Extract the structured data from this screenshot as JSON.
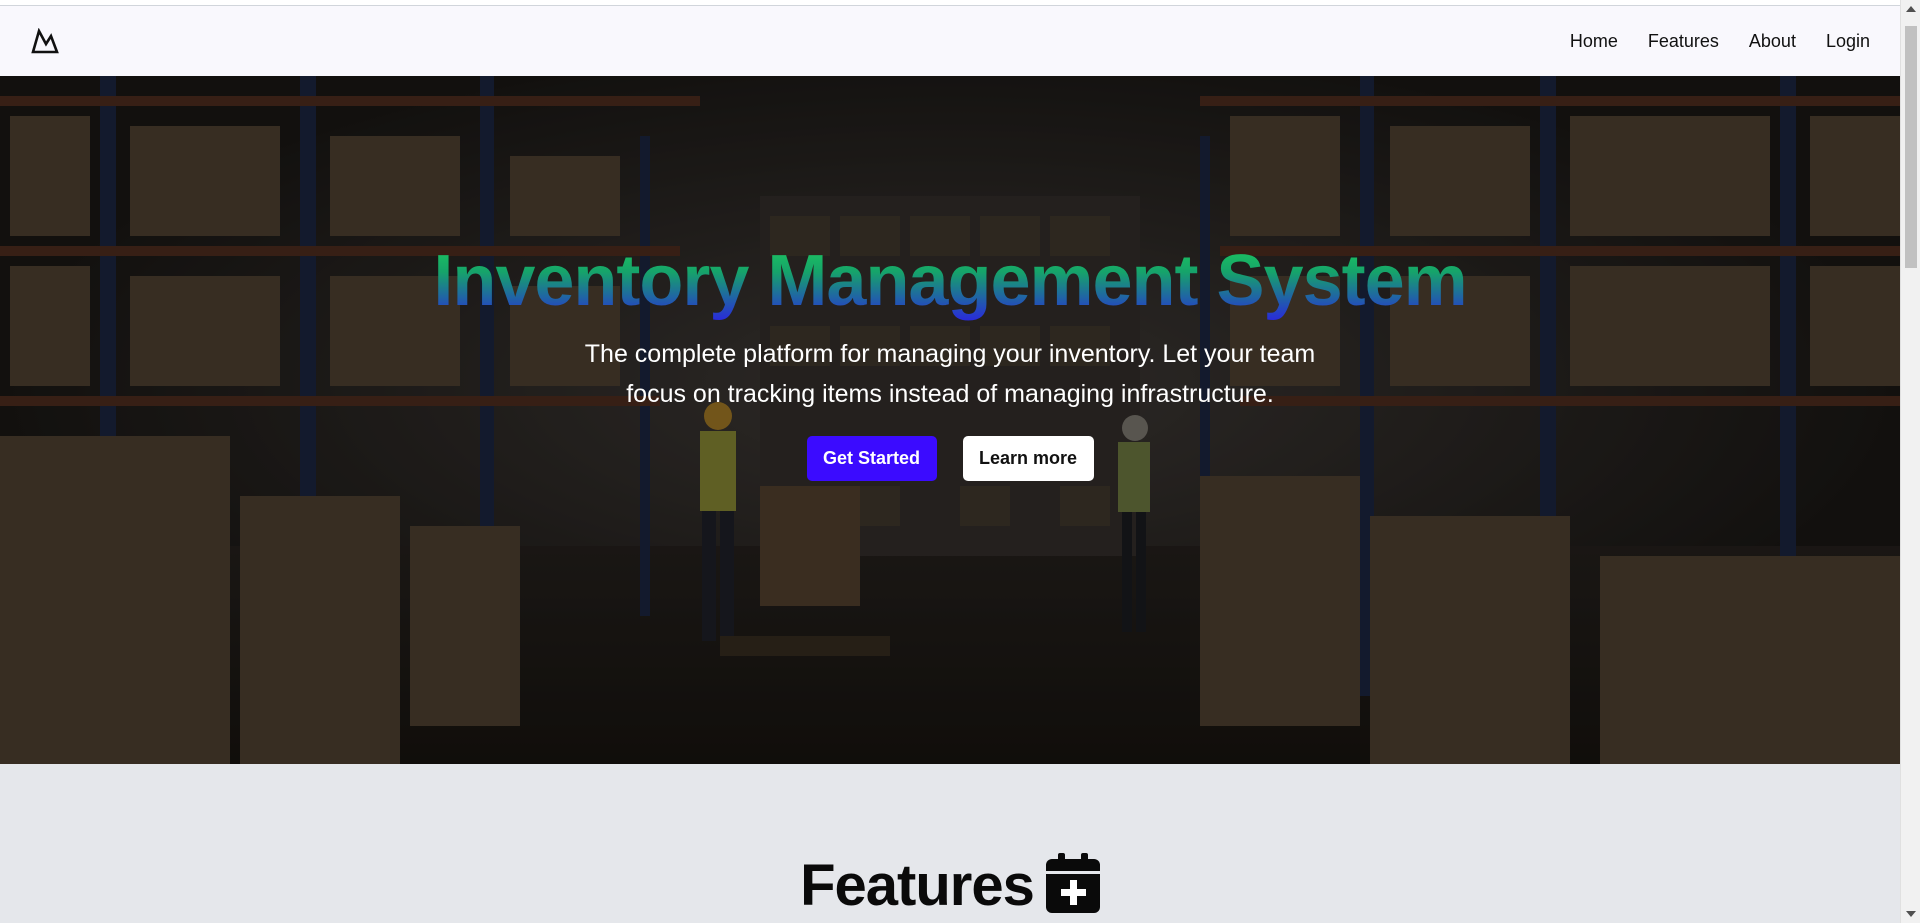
{
  "navbar": {
    "logo_icon": "mountain-icon",
    "links": [
      {
        "label": "Home"
      },
      {
        "label": "Features"
      },
      {
        "label": "About"
      },
      {
        "label": "Login"
      }
    ]
  },
  "hero": {
    "title": "Inventory Management System",
    "subtitle": "The complete platform for managing your inventory. Let your team focus on tracking items instead of managing infrastructure.",
    "primary_button": "Get Started",
    "secondary_button": "Learn more",
    "background": "warehouse-photo",
    "title_gradient": [
      "#1fd45a",
      "#2b1ce8"
    ]
  },
  "features": {
    "title": "Features",
    "icon": "calendar-plus-icon"
  },
  "colors": {
    "primary": "#3b0bff",
    "navbar_bg": "#f9f8fd",
    "section_bg": "#e5e7eb"
  }
}
